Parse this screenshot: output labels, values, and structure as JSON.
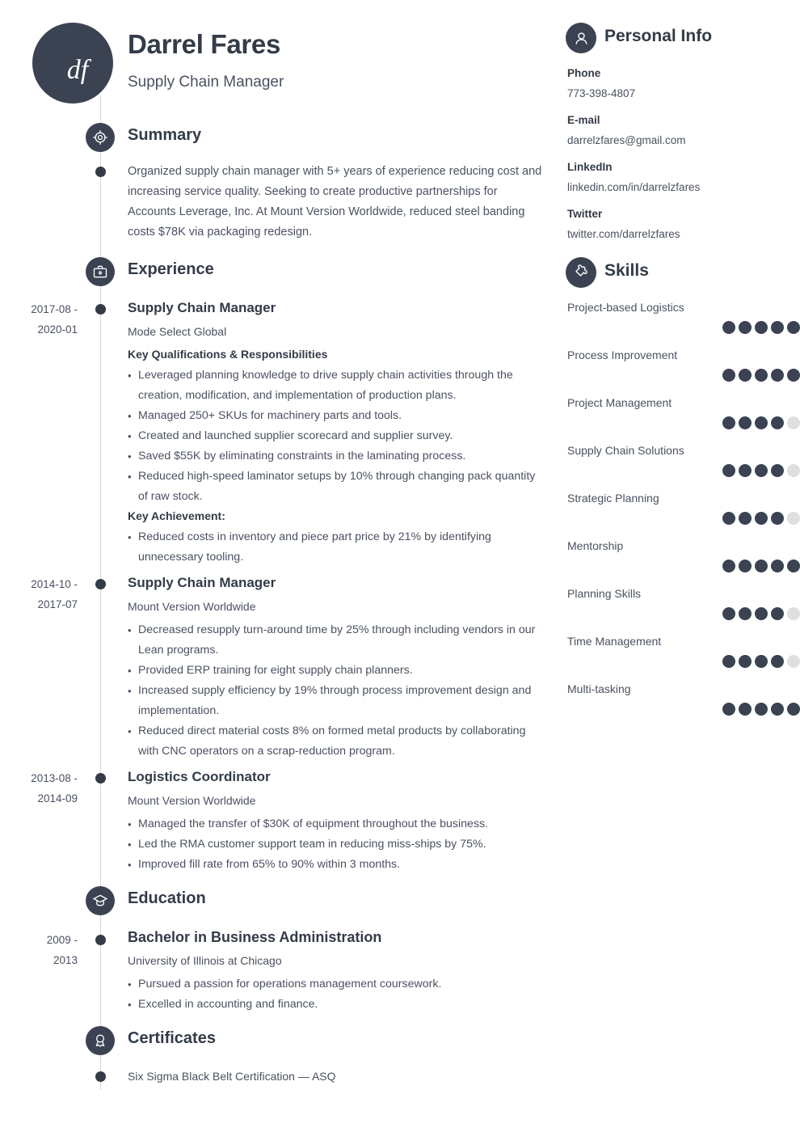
{
  "header": {
    "initials": "df",
    "name": "Darrel Fares",
    "job_title": "Supply Chain Manager"
  },
  "colors": {
    "dark": "#3b4252",
    "text": "#4a5160",
    "heading": "#333b48",
    "rail": "#d5d7da",
    "dot_off": "#dedfe1"
  },
  "sections": {
    "summary": {
      "title": "Summary",
      "icon": "target-icon",
      "text": "Organized supply chain manager with 5+ years of experience reducing cost and increasing service quality. Seeking to create productive partnerships for Accounts Leverage, Inc. At Mount Version Worldwide, reduced steel banding costs $78K via packaging redesign."
    },
    "experience": {
      "title": "Experience",
      "icon": "briefcase-icon",
      "jobs": [
        {
          "dates": [
            "2017-08 -",
            "2020-01"
          ],
          "title": "Supply Chain Manager",
          "company": "Mode Select Global",
          "subhead": "Key Qualifications & Responsibilities",
          "bullets": [
            "Leveraged planning knowledge to drive supply chain activities through the creation, modification, and implementation of production plans.",
            "Managed 250+ SKUs for machinery parts and tools.",
            "Created and launched supplier scorecard and supplier survey.",
            "Saved $55K by eliminating constraints in the laminating process.",
            "Reduced high-speed laminator setups by 10% through changing pack quantity of raw stock."
          ],
          "achievement_head": "Key Achievement:",
          "achievement_bullets": [
            "Reduced costs in inventory and piece part price by 21% by identifying unnecessary tooling."
          ]
        },
        {
          "dates": [
            "2014-10 -",
            "2017-07"
          ],
          "title": "Supply Chain Manager",
          "company": "Mount Version Worldwide",
          "bullets": [
            "Decreased resupply turn-around time by 25% through including vendors in our Lean programs.",
            "Provided ERP training for eight supply chain planners.",
            "Increased supply efficiency by 19% through process improvement design and implementation.",
            "Reduced direct material costs 8% on formed metal products by collaborating with CNC operators on a scrap-reduction program."
          ]
        },
        {
          "dates": [
            "2013-08 -",
            "2014-09"
          ],
          "title": "Logistics Coordinator",
          "company": "Mount Version Worldwide",
          "bullets": [
            "Managed the transfer of $30K of equipment throughout the business.",
            "Led the RMA customer support team in reducing miss-ships by 75%.",
            "Improved fill rate from 65% to 90% within 3 months."
          ]
        }
      ]
    },
    "education": {
      "title": "Education",
      "icon": "graduation-cap-icon",
      "entries": [
        {
          "dates": [
            "2009 -",
            "2013"
          ],
          "title": "Bachelor in Business Administration",
          "school": "University of Illinois at Chicago",
          "bullets": [
            "Pursued a passion for operations management coursework.",
            "Excelled in accounting and finance."
          ]
        }
      ]
    },
    "certificates": {
      "title": "Certificates",
      "icon": "award-ribbon-icon",
      "items": [
        "Six Sigma Black Belt Certification — ASQ"
      ]
    }
  },
  "sidebar": {
    "personal_info": {
      "title": "Personal Info",
      "icon": "person-icon",
      "fields": [
        {
          "label": "Phone",
          "value": "773-398-4807"
        },
        {
          "label": "E-mail",
          "value": "darrelzfares@gmail.com"
        },
        {
          "label": "LinkedIn",
          "value": "linkedin.com/in/darrelzfares"
        },
        {
          "label": "Twitter",
          "value": "twitter.com/darrelzfares"
        }
      ]
    },
    "skills": {
      "title": "Skills",
      "icon": "puzzle-piece-icon",
      "max_rating": 5,
      "items": [
        {
          "name": "Project-based Logistics",
          "rating": 5
        },
        {
          "name": "Process Improvement",
          "rating": 5
        },
        {
          "name": "Project Management",
          "rating": 4
        },
        {
          "name": "Supply Chain Solutions",
          "rating": 4
        },
        {
          "name": "Strategic Planning",
          "rating": 4
        },
        {
          "name": "Mentorship",
          "rating": 5
        },
        {
          "name": "Planning Skills",
          "rating": 4
        },
        {
          "name": "Time Management",
          "rating": 4
        },
        {
          "name": "Multi-tasking",
          "rating": 5
        }
      ]
    }
  }
}
